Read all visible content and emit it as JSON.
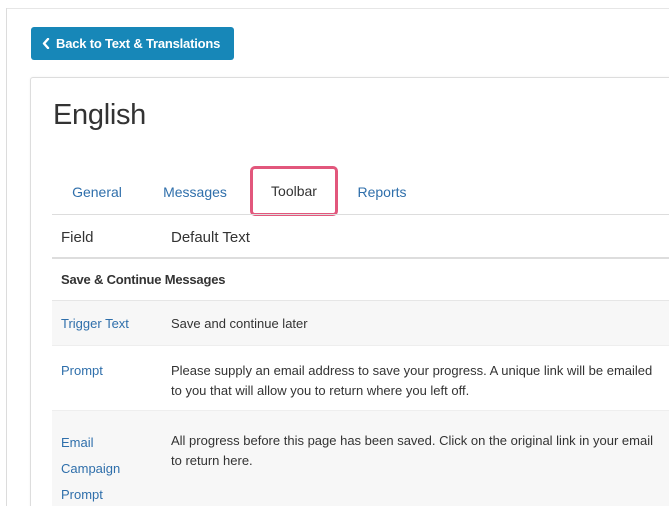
{
  "back_button": {
    "label": "Back to Text & Translations",
    "icon": "chevron-left-icon"
  },
  "title": "English",
  "tabs": [
    {
      "label": "General"
    },
    {
      "label": "Messages"
    },
    {
      "label": "Toolbar",
      "active": true
    },
    {
      "label": "Reports"
    }
  ],
  "table": {
    "headers": {
      "field": "Field",
      "default_text": "Default Text"
    },
    "section": "Save & Continue Messages",
    "rows": [
      {
        "field": "Trigger Text",
        "value": "Save and continue later"
      },
      {
        "field": "Prompt",
        "value": "Please supply an email address to save your progress. A unique link will be emailed to you that will allow you to return where you left off."
      },
      {
        "field_lines": [
          "Email",
          "Campaign",
          "Prompt"
        ],
        "value": "All progress before this page has been saved. Click on the original link in your email to return here."
      }
    ]
  },
  "colors": {
    "accent": "#1787b8",
    "link": "#2f6fab",
    "highlight": "#e2577c"
  }
}
